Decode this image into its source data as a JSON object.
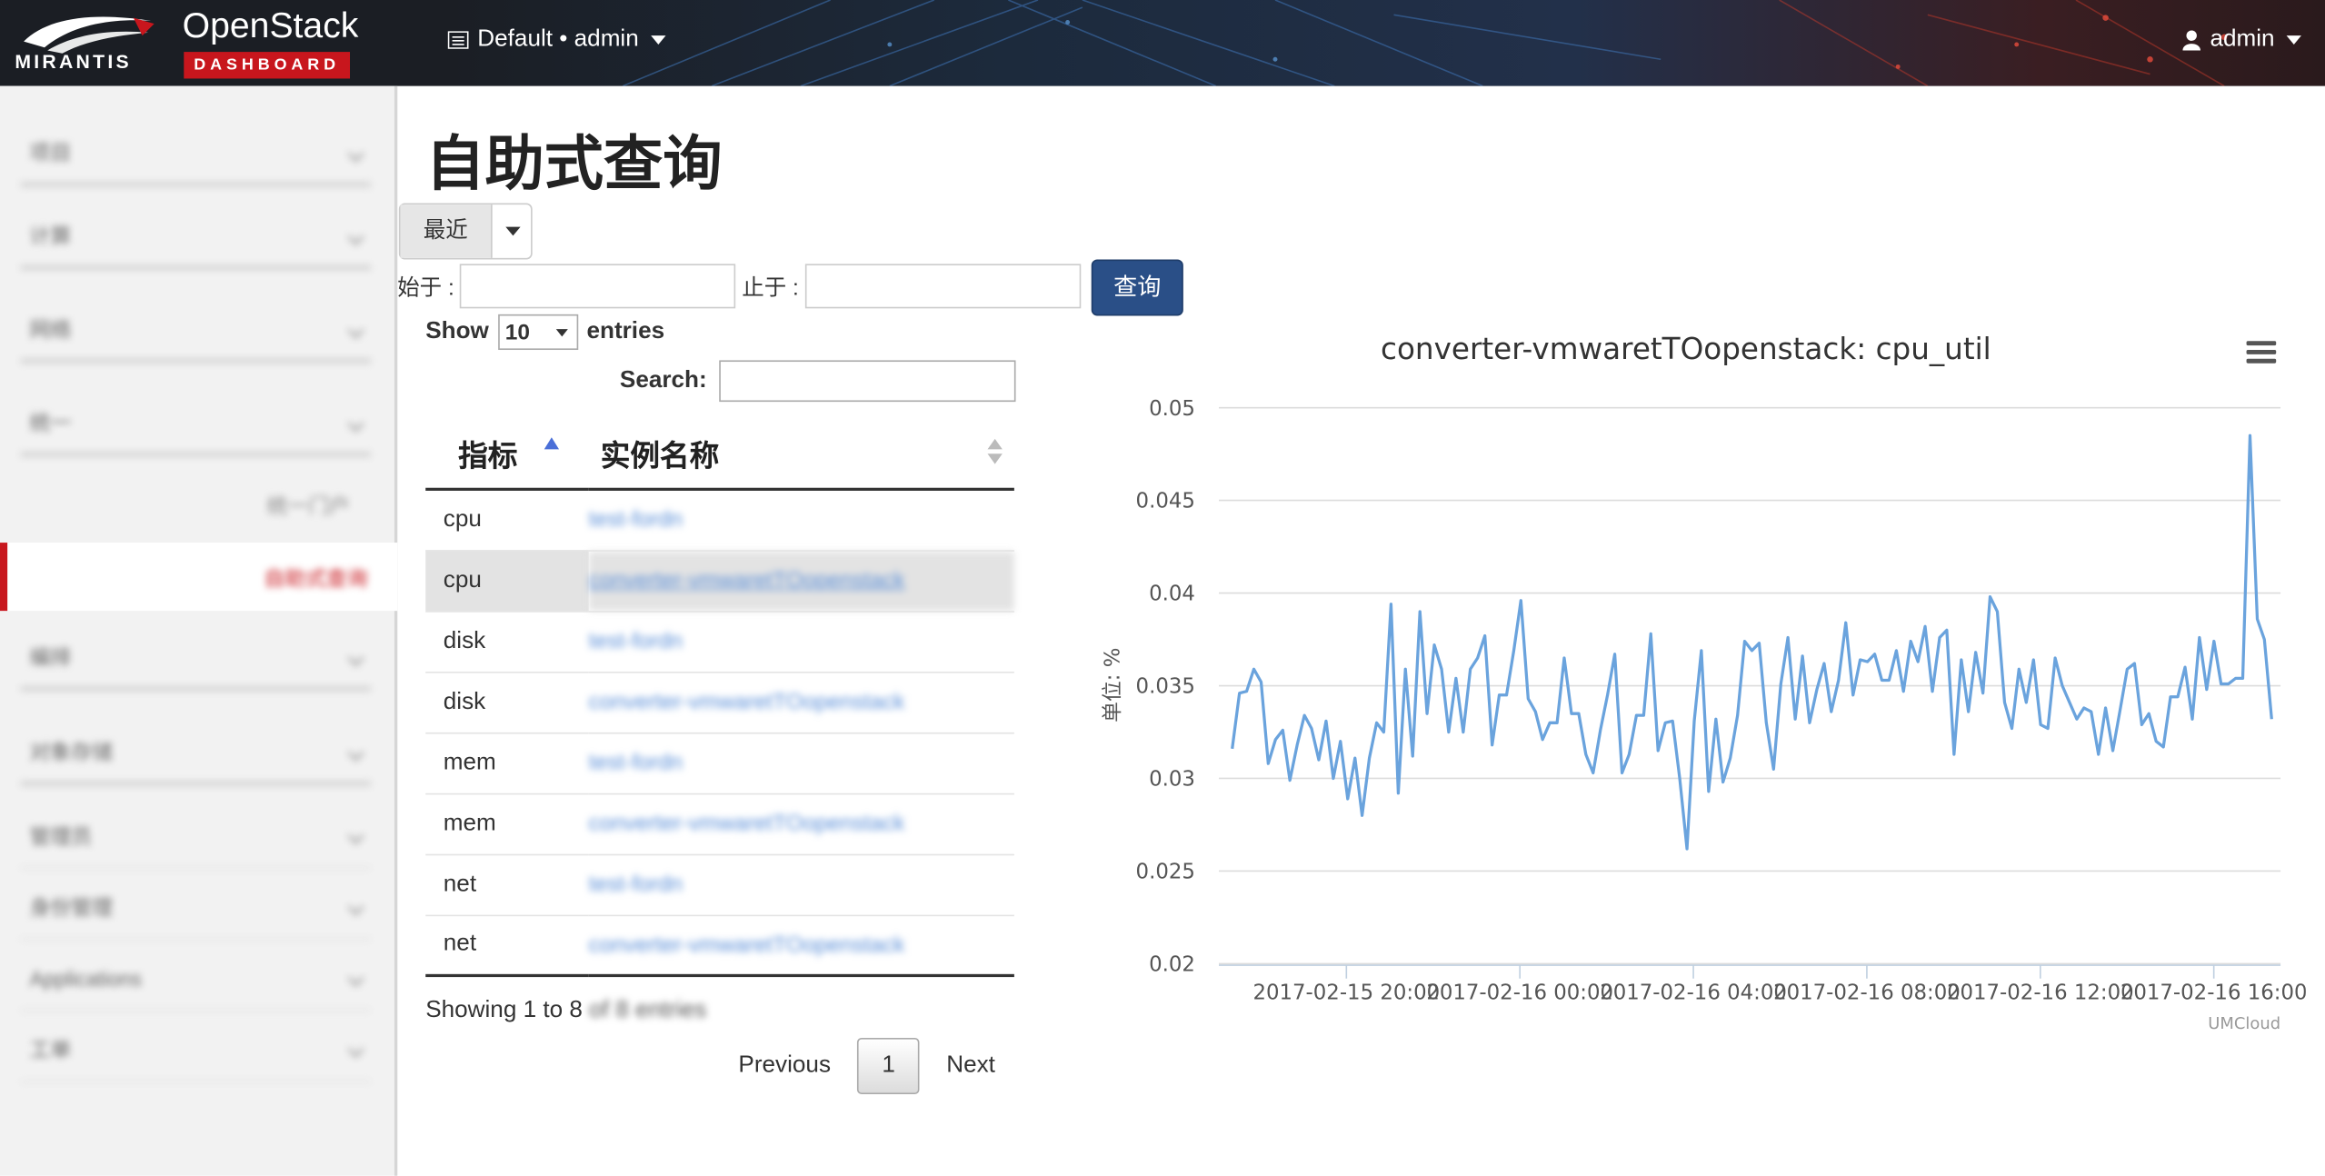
{
  "topbar": {
    "brand_mirantis": "MIRANTIS",
    "brand_openstack": "OpenStack",
    "brand_dashboard": "DASHBOARD",
    "project_label": "Default • admin",
    "user_label": "admin"
  },
  "sidebar": {
    "items": [
      {
        "label": "项目"
      },
      {
        "label": "计算"
      },
      {
        "label": "网络"
      },
      {
        "label": "统一"
      },
      {
        "label": "统一门户"
      },
      {
        "label": "自助式查询"
      },
      {
        "label": "编排"
      },
      {
        "label": "对象存储"
      },
      {
        "label": "管理员"
      },
      {
        "label": "身份管理"
      },
      {
        "label": "Applications"
      },
      {
        "label": "工单"
      }
    ]
  },
  "main": {
    "title": "自助式查询",
    "recent_button": "最近",
    "from_label": "始于 :",
    "to_label": "止于 :",
    "query_button": "查询",
    "show_label": "Show",
    "entries_label": "entries",
    "page_length": "10",
    "search_label": "Search:",
    "columns": [
      "指标",
      "实例名称"
    ],
    "rows": [
      {
        "metric": "cpu",
        "instance": "test-fordn"
      },
      {
        "metric": "cpu",
        "instance": "converter-vmwaretTOopenstack"
      },
      {
        "metric": "disk",
        "instance": "test-fordn"
      },
      {
        "metric": "disk",
        "instance": "converter-vmwaretTOopenstack"
      },
      {
        "metric": "mem",
        "instance": "test-fordn"
      },
      {
        "metric": "mem",
        "instance": "converter-vmwaretTOopenstack"
      },
      {
        "metric": "net",
        "instance": "test-fordn"
      },
      {
        "metric": "net",
        "instance": "converter-vmwaretTOopenstack"
      }
    ],
    "info_visible": "Showing 1 to 8",
    "info_blurred": "of 8 entries",
    "prev_label": "Previous",
    "current_page": "1",
    "next_label": "Next"
  },
  "colors": {
    "topbar_bg": "#1b1e24",
    "accent_red": "#c8161d",
    "query_button": "#2a4f87",
    "series_line": "#6aa3dd"
  },
  "chart_data": {
    "type": "line",
    "title": "converter-vmwaretTOopenstack: cpu_util",
    "ylabel": "单位: %",
    "xlabel": "",
    "ylim": [
      0.02,
      0.05
    ],
    "yticks": [
      "0.05",
      "0.045",
      "0.04",
      "0.035",
      "0.03",
      "0.025",
      "0.02"
    ],
    "xticks": [
      "2017-02-15 20:00",
      "2017-02-16 00:00",
      "2017-02-16 04:00",
      "2017-02-16 08:00",
      "2017-02-16 12:00",
      "2017-02-16 16:00"
    ],
    "credit": "UMCloud",
    "series": [
      {
        "values": [
          0.0316,
          0.0346,
          0.0347,
          0.0359,
          0.0352,
          0.0308,
          0.0321,
          0.0326,
          0.0299,
          0.0318,
          0.0334,
          0.0327,
          0.031,
          0.0331,
          0.03,
          0.032,
          0.0289,
          0.0311,
          0.028,
          0.0311,
          0.033,
          0.0325,
          0.0394,
          0.0292,
          0.0359,
          0.0312,
          0.039,
          0.0335,
          0.0372,
          0.0359,
          0.0325,
          0.0354,
          0.0325,
          0.0359,
          0.0365,
          0.0377,
          0.0318,
          0.0345,
          0.0345,
          0.0369,
          0.0396,
          0.0343,
          0.0336,
          0.0321,
          0.033,
          0.033,
          0.0365,
          0.0335,
          0.0335,
          0.0313,
          0.0303,
          0.0326,
          0.0345,
          0.0367,
          0.0303,
          0.0313,
          0.0334,
          0.0334,
          0.0378,
          0.0315,
          0.033,
          0.0331,
          0.03,
          0.0262,
          0.0331,
          0.0369,
          0.0293,
          0.0332,
          0.0298,
          0.0311,
          0.0334,
          0.0374,
          0.0369,
          0.0373,
          0.033,
          0.0305,
          0.0351,
          0.0376,
          0.0332,
          0.0366,
          0.033,
          0.0348,
          0.0362,
          0.0336,
          0.0353,
          0.0384,
          0.0345,
          0.0364,
          0.0363,
          0.0367,
          0.0353,
          0.0353,
          0.0369,
          0.0347,
          0.0374,
          0.0363,
          0.0382,
          0.0347,
          0.0376,
          0.038,
          0.0313,
          0.0364,
          0.0336,
          0.0368,
          0.0346,
          0.0398,
          0.039,
          0.0341,
          0.0327,
          0.0359,
          0.0341,
          0.0364,
          0.0329,
          0.0327,
          0.0365,
          0.035,
          0.0341,
          0.0332,
          0.0338,
          0.0336,
          0.0313,
          0.0338,
          0.0315,
          0.0337,
          0.0359,
          0.0362,
          0.0329,
          0.0335,
          0.032,
          0.0317,
          0.0344,
          0.0344,
          0.036,
          0.0332,
          0.0376,
          0.0348,
          0.0374,
          0.0351,
          0.0351,
          0.0354,
          0.0354,
          0.0485,
          0.0386,
          0.0375,
          0.0332
        ]
      }
    ]
  }
}
